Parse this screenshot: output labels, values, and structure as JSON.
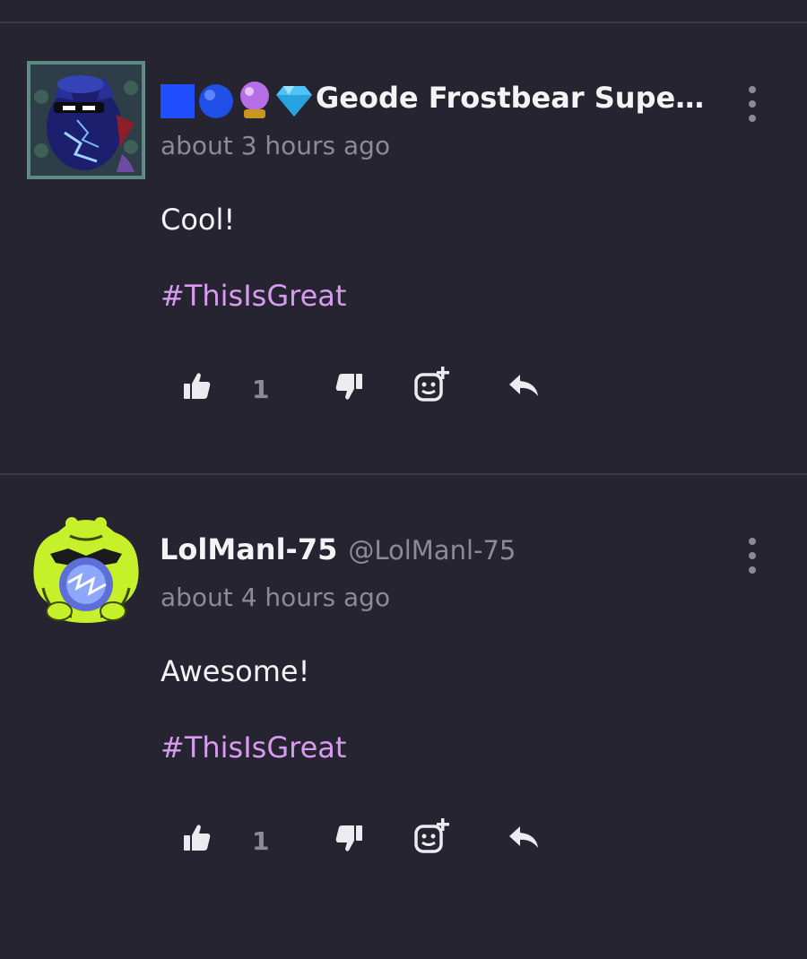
{
  "comments": [
    {
      "username": "Geode Frostbear Super S...",
      "handle": "",
      "timestamp": "about 3 hours ago",
      "body": "Cool!",
      "hashtag": "#ThisIsGreat",
      "like_count": "1",
      "badges": [
        "blue-square",
        "blue-sphere",
        "crystal-ball",
        "gem"
      ]
    },
    {
      "username": "LolManl-75",
      "handle": "@LolManl-75",
      "timestamp": "about 4 hours ago",
      "body": "Awesome!",
      "hashtag": "#ThisIsGreat",
      "like_count": "1"
    }
  ],
  "colors": {
    "background": "#262430",
    "divider": "#3c3a46",
    "muted_text": "#8c8a94",
    "hashtag": "#d79bf0"
  },
  "icons": [
    "like-icon",
    "dislike-icon",
    "add-reaction-icon",
    "reply-icon",
    "more-options-icon"
  ]
}
